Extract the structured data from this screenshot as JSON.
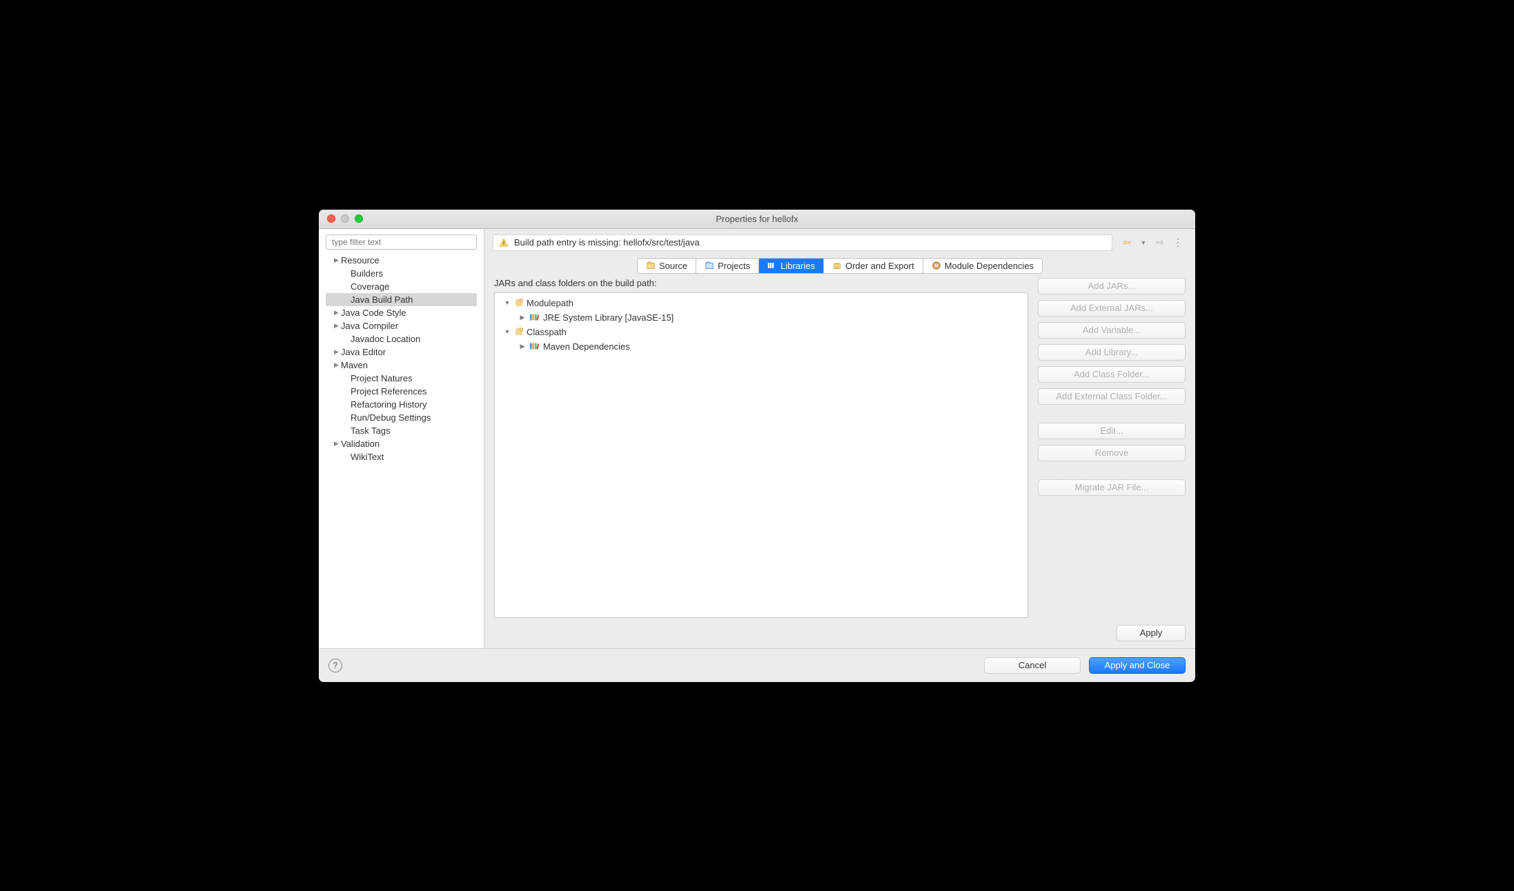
{
  "window": {
    "title": "Properties for hellofx"
  },
  "sidebar": {
    "filter_placeholder": "type filter text",
    "items": [
      {
        "label": "Resource",
        "expandable": true,
        "indent": false
      },
      {
        "label": "Builders",
        "expandable": false,
        "indent": true
      },
      {
        "label": "Coverage",
        "expandable": false,
        "indent": true
      },
      {
        "label": "Java Build Path",
        "expandable": false,
        "indent": true,
        "selected": true
      },
      {
        "label": "Java Code Style",
        "expandable": true,
        "indent": false
      },
      {
        "label": "Java Compiler",
        "expandable": true,
        "indent": false
      },
      {
        "label": "Javadoc Location",
        "expandable": false,
        "indent": true
      },
      {
        "label": "Java Editor",
        "expandable": true,
        "indent": false
      },
      {
        "label": "Maven",
        "expandable": true,
        "indent": false
      },
      {
        "label": "Project Natures",
        "expandable": false,
        "indent": true
      },
      {
        "label": "Project References",
        "expandable": false,
        "indent": true
      },
      {
        "label": "Refactoring History",
        "expandable": false,
        "indent": true
      },
      {
        "label": "Run/Debug Settings",
        "expandable": false,
        "indent": true
      },
      {
        "label": "Task Tags",
        "expandable": false,
        "indent": true
      },
      {
        "label": "Validation",
        "expandable": true,
        "indent": false
      },
      {
        "label": "WikiText",
        "expandable": false,
        "indent": true
      }
    ]
  },
  "banner": {
    "message": "Build path entry is missing: hellofx/src/test/java"
  },
  "tabs": [
    {
      "label": "Source",
      "icon": "source"
    },
    {
      "label": "Projects",
      "icon": "projects"
    },
    {
      "label": "Libraries",
      "icon": "libraries",
      "active": true
    },
    {
      "label": "Order and Export",
      "icon": "order"
    },
    {
      "label": "Module Dependencies",
      "icon": "module"
    }
  ],
  "main": {
    "heading": "JARs and class folders on the build path:",
    "tree": {
      "modulepath_label": "Modulepath",
      "jre_label": "JRE System Library [JavaSE-15]",
      "classpath_label": "Classpath",
      "maven_label": "Maven Dependencies"
    },
    "buttons": {
      "add_jars": "Add JARs...",
      "add_external_jars": "Add External JARs...",
      "add_variable": "Add Variable...",
      "add_library": "Add Library...",
      "add_class_folder": "Add Class Folder...",
      "add_external_class_folder": "Add External Class Folder...",
      "edit": "Edit...",
      "remove": "Remove",
      "migrate": "Migrate JAR File..."
    },
    "apply": "Apply"
  },
  "footer": {
    "cancel": "Cancel",
    "apply_close": "Apply and Close"
  }
}
